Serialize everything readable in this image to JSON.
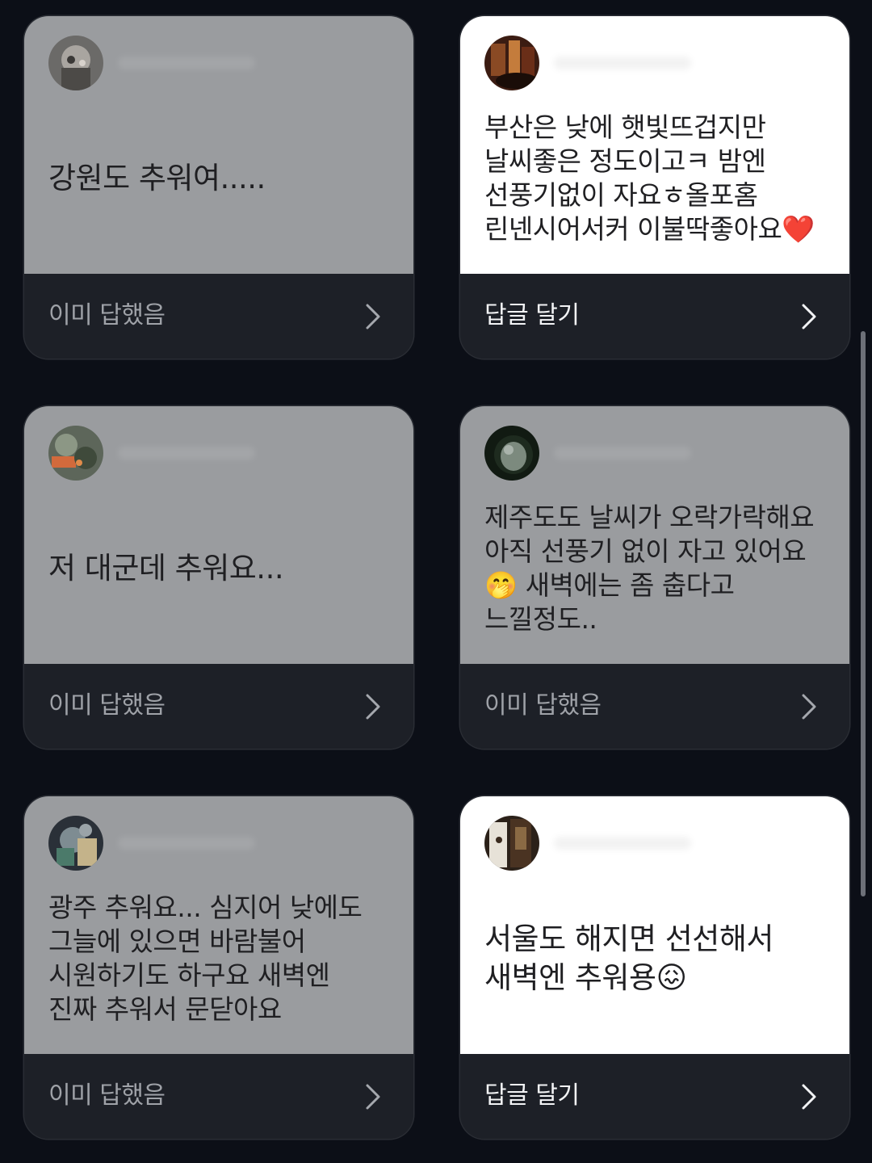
{
  "cards": [
    {
      "message": "강원도 추워여.....",
      "action_label": "이미 답했음",
      "state": "answered"
    },
    {
      "message": "부산은 낮에 햇빛뜨겁지만\n날씨좋은 정도이고ㅋ 밤엔\n선풍기없이 자요ㅎ올포홈\n린넨시어서커 이불딱좋아요",
      "message_emoji": "❤️",
      "action_label": "답글 달기",
      "state": "unanswered"
    },
    {
      "message": "저 대군데 추워요...",
      "action_label": "이미 답했음",
      "state": "answered"
    },
    {
      "message": "제주도도 날씨가 오락가락해요\n아직 선풍기 없이 자고 있어요\n🤭 새벽에는 좀 춥다고\n느낄정도..",
      "action_label": "이미 답했음",
      "state": "answered"
    },
    {
      "message": "광주 추워요... 심지어 낮에도\n그늘에 있으면 바람불어\n시원하기도 하구요 새벽엔\n진짜 추워서 문닫아요",
      "action_label": "이미 답했음",
      "state": "answered"
    },
    {
      "message": "서울도 해지면 선선해서\n새벽엔 추워용😖",
      "action_label": "답글 달기",
      "state": "unanswered"
    }
  ],
  "icons": {
    "chevron": "chevron-right-icon",
    "avatar": "profile-avatar"
  },
  "colors": {
    "background": "#0c0f17",
    "answered_card": "#9a9c9f",
    "unanswered_card": "#ffffff",
    "footer": "#1d2027",
    "heart": "#e5242b"
  }
}
